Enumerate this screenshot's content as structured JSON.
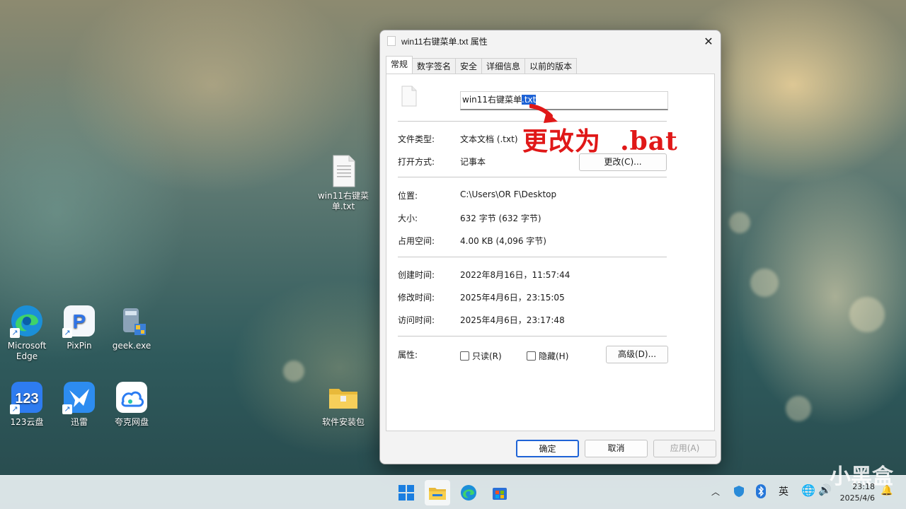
{
  "desktop": {
    "icons": [
      {
        "label": "Microsoft\nEdge",
        "name": "microsoft-edge"
      },
      {
        "label": "PixPin",
        "name": "pixpin"
      },
      {
        "label": "geek.exe",
        "name": "geek-exe"
      },
      {
        "label": "123云盘",
        "name": "123-cloud"
      },
      {
        "label": "迅雷",
        "name": "xunlei"
      },
      {
        "label": "夸克网盘",
        "name": "quark-drive"
      },
      {
        "label": "win11右键菜单.txt",
        "name": "txt-file"
      },
      {
        "label": "软件安装包",
        "name": "software-folder"
      }
    ],
    "edge_line1": "Microsoft",
    "edge_line2": "Edge",
    "txt_line1": "win11右键菜",
    "txt_line2": "单.txt"
  },
  "window": {
    "title": "win11右键菜单.txt 属性",
    "tabs": [
      "常规",
      "数字签名",
      "安全",
      "详细信息",
      "以前的版本"
    ],
    "active_tab": "常规",
    "filename_base": "win11右键菜单",
    "filename_ext": ".txt",
    "file_type_label": "文件类型:",
    "file_type_value": "文本文档 (.txt)",
    "open_with_label": "打开方式:",
    "open_with_value": "记事本",
    "change_button": "更改(C)...",
    "location_label": "位置:",
    "location_value": "C:\\Users\\OR F\\Desktop",
    "size_label": "大小:",
    "size_value": "632 字节 (632 字节)",
    "disk_size_label": "占用空间:",
    "disk_size_value": "4.00 KB (4,096 字节)",
    "created_label": "创建时间:",
    "created_value": "2022年8月16日，11:57:44",
    "modified_label": "修改时间:",
    "modified_value": "2025年4月6日，23:15:05",
    "accessed_label": "访问时间:",
    "accessed_value": "2025年4月6日，23:17:48",
    "attributes_label": "属性:",
    "readonly_label": "只读(R)",
    "hidden_label": "隐藏(H)",
    "advanced_button": "高级(D)...",
    "ok_button": "确定",
    "cancel_button": "取消",
    "apply_button": "应用(A)"
  },
  "annotation": {
    "text": "更改为  .bat",
    "color": "#e01818"
  },
  "taskbar": {
    "ime": "英",
    "time": "23:18",
    "date": "2025/4/6",
    "watermark": "小黑盒"
  },
  "colors": {
    "accent": "#1e63d6",
    "annotation_red": "#e01818"
  }
}
